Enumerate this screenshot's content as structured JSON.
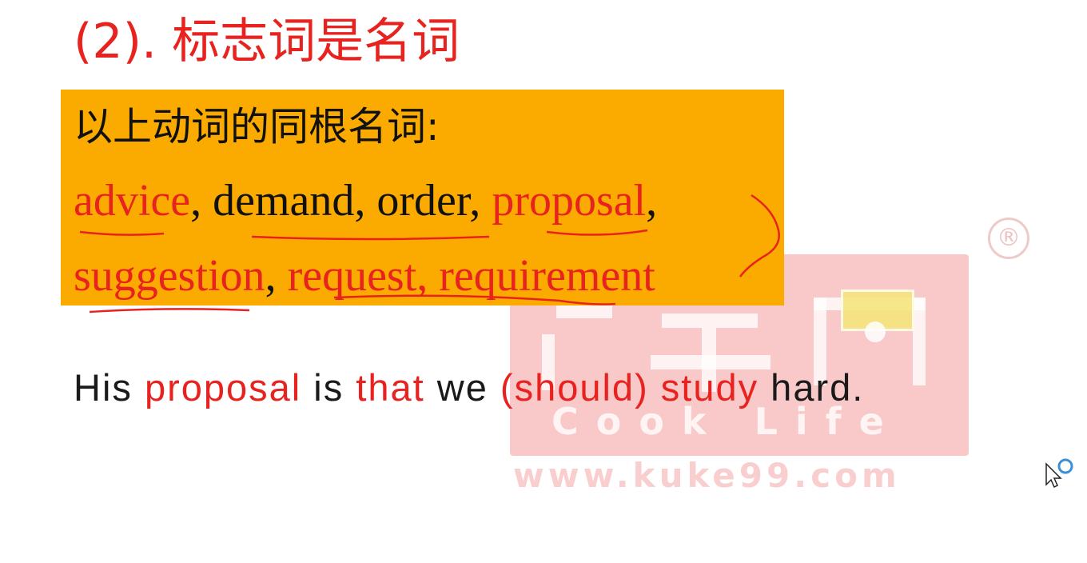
{
  "slide": {
    "title": "(2). 标志词是名词",
    "box": {
      "heading": "以上动词的同根名词:",
      "line1": [
        {
          "text": "advice",
          "highlight": true
        },
        {
          "text": ", demand, order, ",
          "highlight": false
        },
        {
          "text": "proposal",
          "highlight": true
        },
        {
          "text": ",",
          "highlight": false
        }
      ],
      "line2": [
        {
          "text": "suggestion",
          "highlight": true
        },
        {
          "text": ", ",
          "highlight": false
        },
        {
          "text": "request, requirement",
          "highlight": true
        }
      ]
    },
    "sentence": [
      {
        "text": "His ",
        "highlight": false
      },
      {
        "text": "proposal",
        "highlight": true
      },
      {
        "text": " is ",
        "highlight": false
      },
      {
        "text": "that",
        "highlight": true
      },
      {
        "text": " we ",
        "highlight": false
      },
      {
        "text": "(should) study",
        "highlight": true
      },
      {
        "text": " hard.",
        "highlight": false
      }
    ]
  },
  "watermark": {
    "brand": "Cook Life",
    "url": "www.kuke99.com",
    "registered": "®"
  },
  "colors": {
    "highlight": "#e8231f",
    "box_background": "#fbab00",
    "text": "#111111"
  },
  "icons": {
    "cursor": "arrow-cursor-icon",
    "busy": "busy-spinner-icon"
  }
}
